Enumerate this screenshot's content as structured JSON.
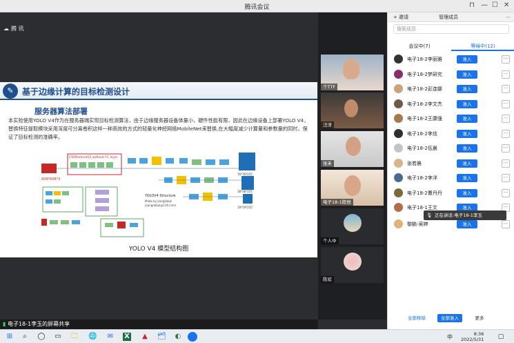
{
  "window": {
    "title": "腾讯会议",
    "pin": "⊓",
    "minimize": "—",
    "maximize": "☐",
    "close": "✕"
  },
  "stage": {
    "label": "腾 讯"
  },
  "slide": {
    "header": "基于边缘计算的目标检测设计",
    "subtitle": "服务器算法部署",
    "body": "本实验使用YOLO V4作为在服务器端实现目标检测算法，由于边缘服务器设备体量小，硬件性能有限，因此在边缘设备上部署YOLO V4，替换特征提取模块采用深度可分离卷积这样一种高效的方式的轻量化神经网络MobileNet来替换,在大幅度减少计算量和参数量的同时，保证了目标检测的准确率。",
    "caption": "YOLO V4 模型结构图",
    "diagram": {
      "input": "608*608*3",
      "backbone": "CSPDarknet53 without FC layer",
      "outputs": [
        "76*76*255",
        "38*38*255",
        "19*19*255"
      ],
      "legend_title": "YOLOV4 Structure",
      "legend_made": "Made by Jiangdabai",
      "legend_mail": "(jiangdabai@126.com)"
    }
  },
  "share_bar": {
    "text": "电子18-1李玉的屏幕共享"
  },
  "video_tiles": [
    {
      "name": "个TTF"
    },
    {
      "name": "汪洋"
    },
    {
      "name": "张禾"
    },
    {
      "name": "电子18-1陈悦"
    },
    {
      "name": "个人中"
    },
    {
      "name": "陈欢"
    }
  ],
  "panel": {
    "tabs": [
      "+ 邀请",
      "管理成员"
    ],
    "search_placeholder": "搜索成员",
    "segments": [
      "会议中(7)",
      "等候中(12)"
    ],
    "admit_label": "准入",
    "more_label": "···",
    "members": [
      {
        "name": "电子18-2李丽雅",
        "color": "#333"
      },
      {
        "name": "电子18-2梦研究",
        "color": "#8a2d6b"
      },
      {
        "name": "电子18-2彭连娜",
        "color": "#c9a47a"
      },
      {
        "name": "电子18-2李文杰",
        "color": "#6f5a4a"
      },
      {
        "name": "电子18-2王康强",
        "color": "#a67b4b"
      },
      {
        "name": "电子18-2李炫",
        "color": "#2f2f2f"
      },
      {
        "name": "电子18-2伍晨",
        "color": "#c5c5c5"
      },
      {
        "name": "张若晨",
        "color": "#d9b48a"
      },
      {
        "name": "电子18-2李洋",
        "color": "#4b6a8f"
      },
      {
        "name": "电子18-2曹丹丹",
        "color": "#7a6a3c"
      },
      {
        "name": "电子18-1王文",
        "color": "#b66e4a"
      },
      {
        "name": "黎鹏-吴婷",
        "color": "#e0b37a"
      }
    ],
    "tooltip": "正在讲话:电子18-1李玉",
    "bottom_buttons": [
      "全部移除",
      "全部准入",
      "更多"
    ]
  },
  "taskbar": {
    "time": "8:36",
    "date": "2022/5/31",
    "ime": "中",
    "icons": [
      "⊞",
      "⌕",
      "◯",
      "▭",
      "🗀",
      "🌐",
      "✉",
      "X",
      "▲",
      "🗂",
      "◐"
    ]
  }
}
